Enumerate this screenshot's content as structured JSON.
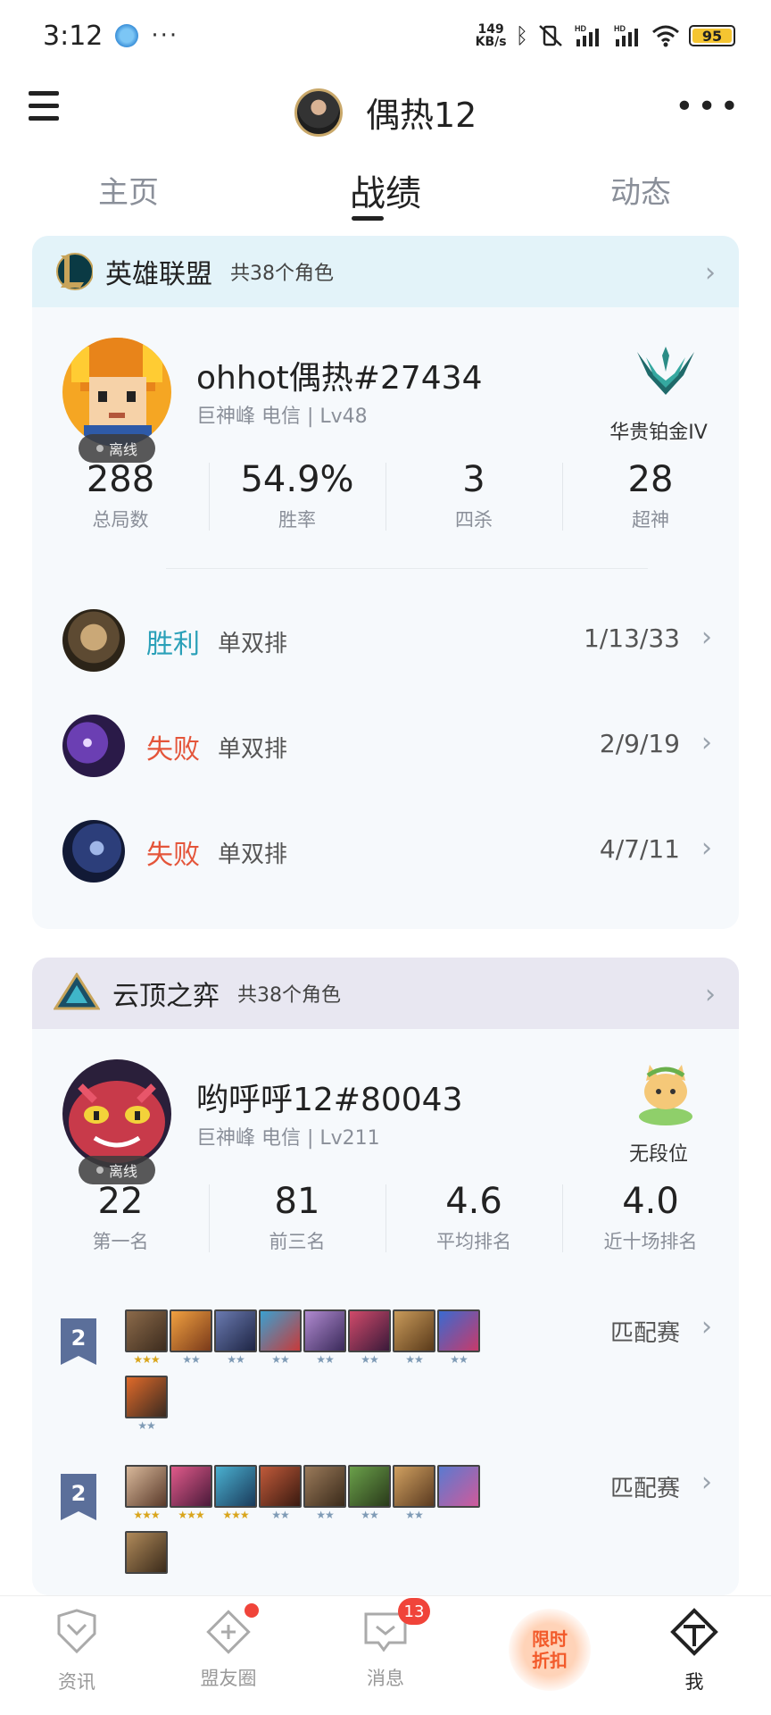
{
  "status_bar": {
    "time": "3:12",
    "more": "···",
    "speed_top": "149",
    "speed_bottom": "KB/s",
    "hd1": "HD",
    "hd2": "HD",
    "battery": "95"
  },
  "header": {
    "title": "偶热12"
  },
  "tabs": [
    "主页",
    "战绩",
    "动态"
  ],
  "lol": {
    "game": "英雄联盟",
    "roles": "共38个角色",
    "player_name": "ohhot偶热#27434",
    "player_sub": "巨神峰 电信 | Lv48",
    "status": "离线",
    "rank": "华贵铂金IV",
    "stats": [
      {
        "value": "288",
        "label": "总局数"
      },
      {
        "value": "54.9%",
        "label": "胜率"
      },
      {
        "value": "3",
        "label": "四杀"
      },
      {
        "value": "28",
        "label": "超神"
      }
    ],
    "matches": [
      {
        "result": "胜利",
        "queue": "单双排",
        "kda": "1/13/33"
      },
      {
        "result": "失败",
        "queue": "单双排",
        "kda": "2/9/19"
      },
      {
        "result": "失败",
        "queue": "单双排",
        "kda": "4/7/11"
      }
    ]
  },
  "tft": {
    "game": "云顶之弈",
    "roles": "共38个角色",
    "player_name": "哟呼呼12#80043",
    "player_sub": "巨神峰 电信 | Lv211",
    "status": "离线",
    "rank": "无段位",
    "stats": [
      {
        "value": "22",
        "label": "第一名"
      },
      {
        "value": "81",
        "label": "前三名"
      },
      {
        "value": "4.6",
        "label": "平均排名"
      },
      {
        "value": "4.0",
        "label": "近十场排名"
      }
    ],
    "matches": [
      {
        "place": "2",
        "mode": "匹配赛",
        "stars": [
          "★★★",
          "★★",
          "★★",
          "★★",
          "★★",
          "★★",
          "★★",
          "★★",
          "★★"
        ]
      },
      {
        "place": "2",
        "mode": "匹配赛",
        "stars": [
          "★★★",
          "★★★",
          "★★★",
          "★★",
          "★★",
          "★★",
          "★★",
          "",
          ""
        ]
      }
    ]
  },
  "bottom_nav": {
    "items": [
      "资讯",
      "盟友圈",
      "消息",
      "我"
    ],
    "message_badge": "13",
    "promo_line1": "限时",
    "promo_line2": "折扣"
  },
  "colors": {
    "win": "#2aa0b8",
    "lose": "#e4553a",
    "accent": "#222222"
  }
}
